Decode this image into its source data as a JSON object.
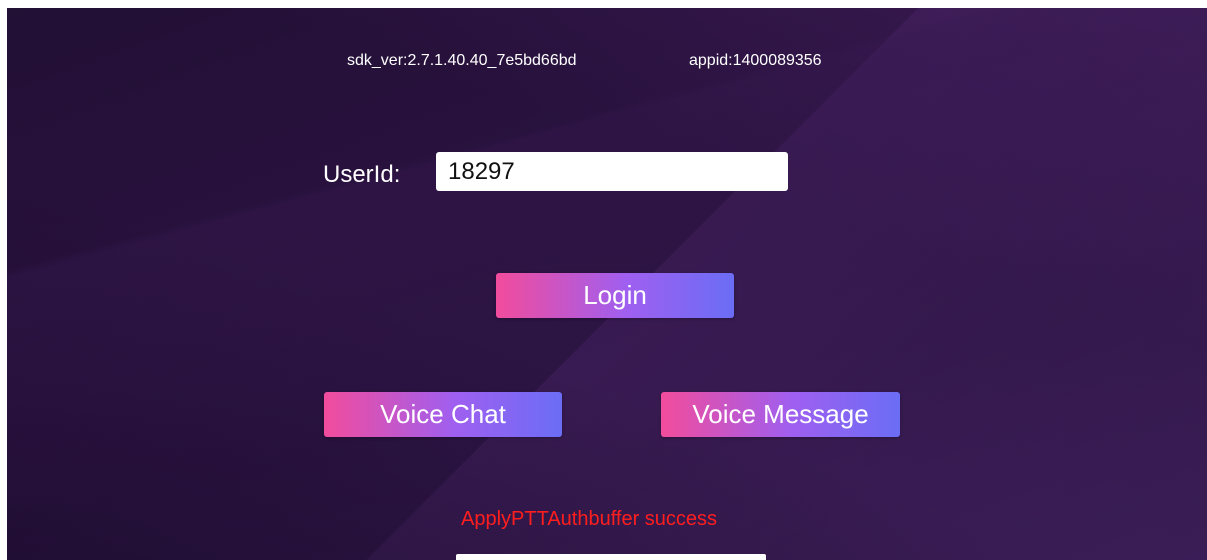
{
  "header": {
    "sdk_version": "sdk_ver:2.7.1.40.40_7e5bd66bd",
    "app_id": "appid:1400089356"
  },
  "login_form": {
    "user_label": "UserId:",
    "user_value": "18297",
    "login_label": "Login"
  },
  "actions": {
    "voice_chat_label": "Voice Chat",
    "voice_message_label": "Voice Message"
  },
  "status": {
    "message": "ApplyPTTAuthbuffer success",
    "color": "#ff1e1e"
  },
  "theme": {
    "background": "#2a1240",
    "button_gradient_start": "#f24c9c",
    "button_gradient_end": "#6b6df5"
  }
}
